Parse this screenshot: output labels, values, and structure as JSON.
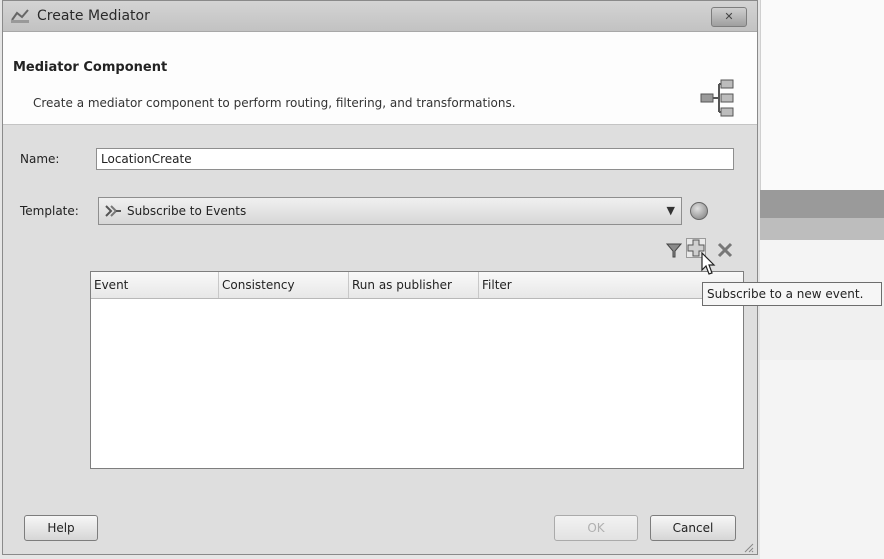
{
  "window": {
    "title": "Create Mediator",
    "close_label": "✕"
  },
  "header": {
    "title": "Mediator Component",
    "description": "Create a mediator component to perform routing, filtering, and transformations."
  },
  "form": {
    "name_label": "Name:",
    "name_value": "LocationCreate",
    "template_label": "Template:",
    "template_value": "Subscribe to Events"
  },
  "table": {
    "columns": [
      "Event",
      "Consistency",
      "Run as publisher",
      "Filter"
    ],
    "rows": []
  },
  "tooltip": {
    "text": "Subscribe to a new event."
  },
  "buttons": {
    "help": "Help",
    "ok": "OK",
    "cancel": "Cancel"
  },
  "icons": {
    "title": "mediator-icon",
    "header": "mediator-component-icon",
    "template": "subscribe-events-icon",
    "help_circle": "help-circle-icon",
    "filter": "filter-icon",
    "add": "add-icon",
    "delete": "delete-icon",
    "cursor": "mouse-pointer-icon",
    "dropdown": "chevron-down-icon"
  }
}
